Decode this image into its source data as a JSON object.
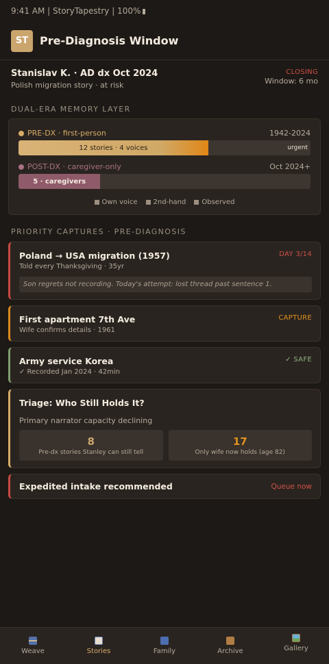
{
  "status_bar": {
    "text": "9:41 AM | StoryTapestry | 100%"
  },
  "header": {
    "logo": "ST",
    "title": "Pre-Diagnosis Window"
  },
  "patient": {
    "name": "Stanislav K. · AD dx Oct 2024",
    "subtitle": "Polish migration story · at risk",
    "status": "CLOSING",
    "window": "Window: 6 mo"
  },
  "memory_layer": {
    "label": "DUAL-ERA MEMORY LAYER",
    "pre": {
      "label": "PRE-DX · first-person",
      "range": "1942-2024",
      "bar_text": "12 stories · 4 voices",
      "urgent": "urgent",
      "fill": 0.65,
      "color": "#d6ac69"
    },
    "post": {
      "label": "POST-DX · caregiver-only",
      "range": "Oct 2024+",
      "bar_text": "5 · caregivers",
      "fill": 0.28,
      "color": "#a97284"
    },
    "legend": [
      "Own voice",
      "2nd-hand",
      "Observed"
    ]
  },
  "priority": {
    "label": "PRIORITY CAPTURES · PRE-DIAGNOSIS",
    "cards": [
      {
        "title": "Poland → USA migration (1957)",
        "subtitle": "Told every Thanksgiving · 35yr",
        "tag": "DAY 3/14",
        "note": "Son regrets not recording. Today's attempt: lost thread past sentence 1."
      },
      {
        "title": "First apartment 7th Ave",
        "subtitle": "Wife confirms details · 1961",
        "tag": "CAPTURE"
      },
      {
        "title": "Army service Korea",
        "subtitle": "✓ Recorded Jan 2024 · 42min",
        "tag": "✓ SAFE"
      }
    ]
  },
  "triage": {
    "title": "Triage: Who Still Holds It?",
    "subtitle": "Primary narrator capacity declining",
    "stats": [
      {
        "value": "8",
        "label": "Pre-dx stories Stanley can still tell"
      },
      {
        "value": "17",
        "label": "Only wife now holds (age 82)"
      }
    ]
  },
  "cta": {
    "title": "Expedited intake recommended",
    "action": "Queue now"
  },
  "tabs": [
    {
      "label": "Weave",
      "icon": "spool-icon"
    },
    {
      "label": "Stories",
      "icon": "book-icon"
    },
    {
      "label": "Family",
      "icon": "family-icon"
    },
    {
      "label": "Archive",
      "icon": "box-icon"
    },
    {
      "label": "Gallery",
      "icon": "picture-icon"
    }
  ],
  "active_tab": "Stories",
  "colors": {
    "accent": "#d6ac69",
    "danger": "#d05048",
    "warning": "#e0921e",
    "safe": "#8fb07f"
  }
}
